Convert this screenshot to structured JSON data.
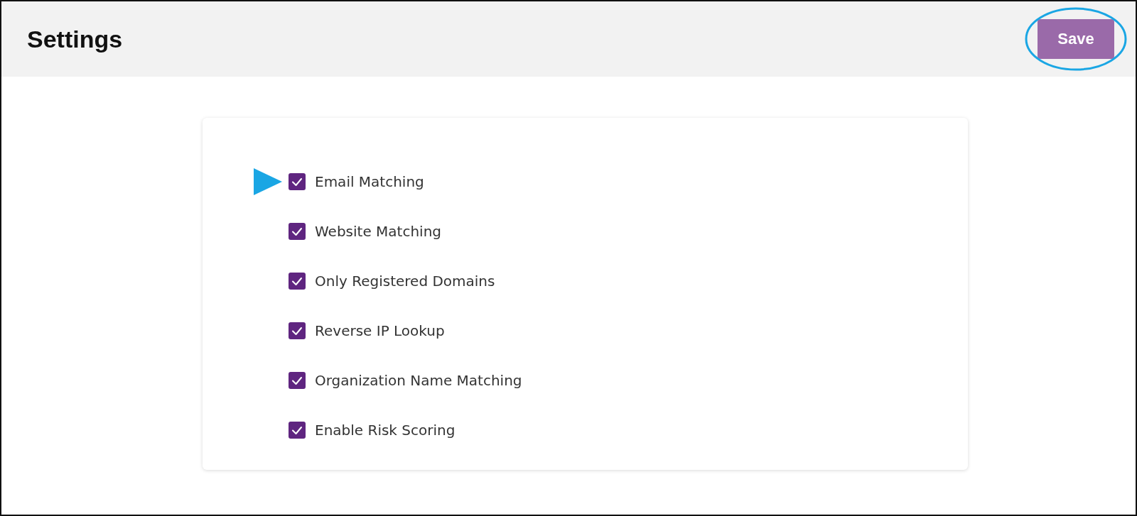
{
  "header": {
    "title": "Settings",
    "save_button": "Save"
  },
  "options": [
    {
      "label": "Email Matching",
      "checked": true
    },
    {
      "label": "Website Matching",
      "checked": true
    },
    {
      "label": "Only Registered Domains",
      "checked": true
    },
    {
      "label": "Reverse IP Lookup",
      "checked": true
    },
    {
      "label": "Organization Name Matching",
      "checked": true
    },
    {
      "label": "Enable Risk Scoring",
      "checked": true
    }
  ]
}
